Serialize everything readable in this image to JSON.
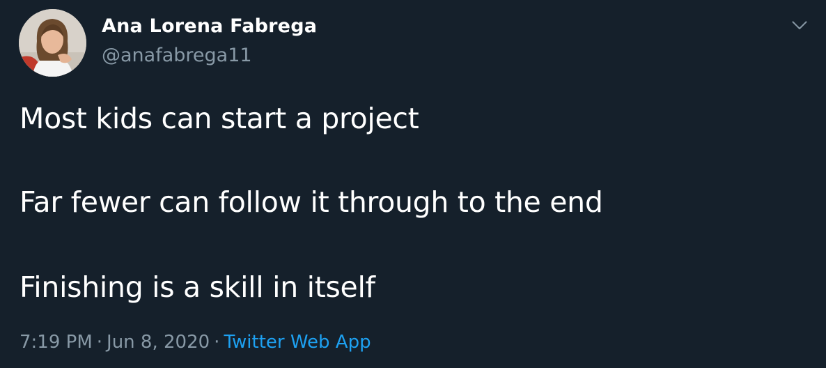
{
  "author": {
    "display_name": "Ana Lorena Fabrega",
    "handle": "@anafabrega11"
  },
  "tweet": {
    "lines": [
      "Most kids can start a project",
      "Far fewer can follow it through to the end",
      "Finishing is a skill in itself"
    ]
  },
  "meta": {
    "time": "7:19 PM",
    "separator": "·",
    "date": "Jun 8, 2020",
    "source": "Twitter Web App"
  },
  "icons": {
    "caret": "chevron-down-icon"
  },
  "colors": {
    "background": "#15202b",
    "primary_text": "#ffffff",
    "secondary_text": "#8899a6",
    "link": "#1da1f2"
  }
}
